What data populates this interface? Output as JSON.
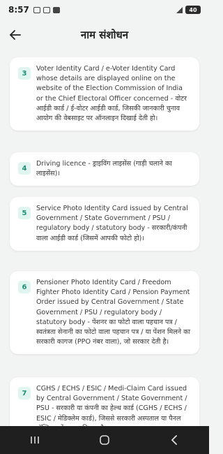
{
  "status": {
    "time": "8:57",
    "battery": "40"
  },
  "header": {
    "title": "नाम संशोधन"
  },
  "items": [
    {
      "number": "3",
      "text": "Voter Identity Card / e-Voter Identity Card whose details are displayed online on the website of the Election Commission of India or the Chief Electoral Officer concerned - वोटर आईडी कार्ड / ई-वोटर आईडी कार्ड, जिसकी जानकारी चुनाव आयोग की वेबसाइट पर ऑनलाइन दिखाई देती हो।"
    },
    {
      "number": "4",
      "text": "Driving licence - ड्राइविंग लाइसेंस (गाड़ी चलाने का लाइसेंस)।"
    },
    {
      "number": "5",
      "text": "Service Photo Identity Card issued by Central Government / State Government / PSU / regulatory body / statutory body - सरकारी/कंपनी वाला आईडी कार्ड (जिसमें आपकी फोटो हो)।"
    },
    {
      "number": "6",
      "text": "Pensioner Photo Identity Card / Freedom Fighter Photo Identity Card / Pension Payment Order issued by Central Government / State Government / PSU / regulatory body / statutory body - पेंशनर का फोटो वाला पहचान पत्र / स्वतंत्रता सेनानी का फोटो वाला पहचान पत्र / या पेंशन मिलने का सरकारी कागज (PPO नंबर वाला), जो सरकार देती है।"
    },
    {
      "number": "7",
      "text": "CGHS / ECHS / ESIC / Medi-Claim Card issued by Central Government / State Government / PSU - सरकारी या कंपनी का हेल्थ कार्ड (CGHS / ECHS / ESIC / मेडिक्लेम कार्ड), जिससे सरकारी अस्पताल या पैनल हॉस्पिटल में इलाज मिलता है।"
    }
  ],
  "colors": {
    "badge_bg": "#e1f5f0",
    "badge_text": "#1e8e74",
    "background": "#f2f4f3"
  }
}
